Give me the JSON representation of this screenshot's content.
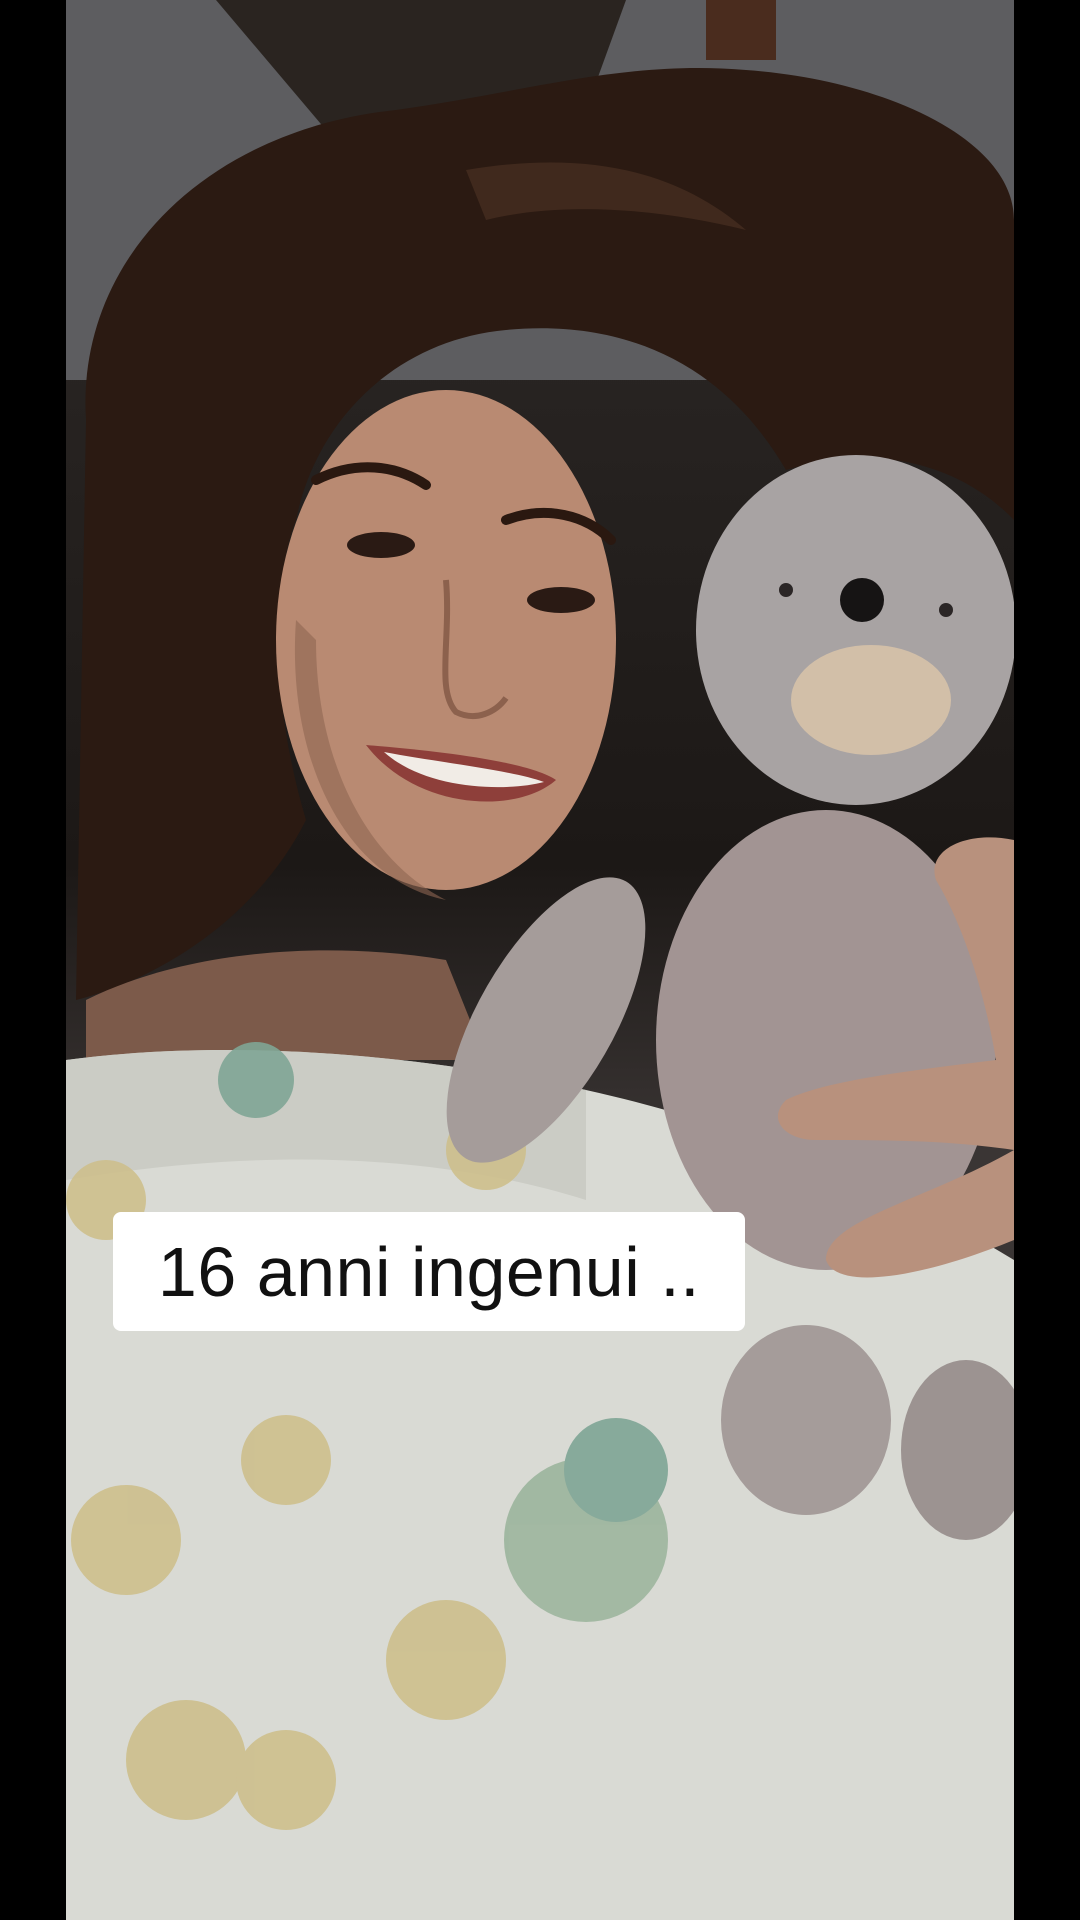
{
  "caption": {
    "text": "16 anni ingenui .."
  },
  "colors": {
    "background": "#000000",
    "caption_bg": "#ffffff",
    "caption_text": "#111111",
    "hair": "#2b1a12",
    "skin": "#b98a72",
    "teddy_bear": "#a59c9a",
    "pillow": "#d9dad4",
    "flower_yellow": "#cdbf8c",
    "flower_green": "#7fa595"
  },
  "photo": {
    "subject": "selfie-person",
    "object": "teddy-bear"
  }
}
